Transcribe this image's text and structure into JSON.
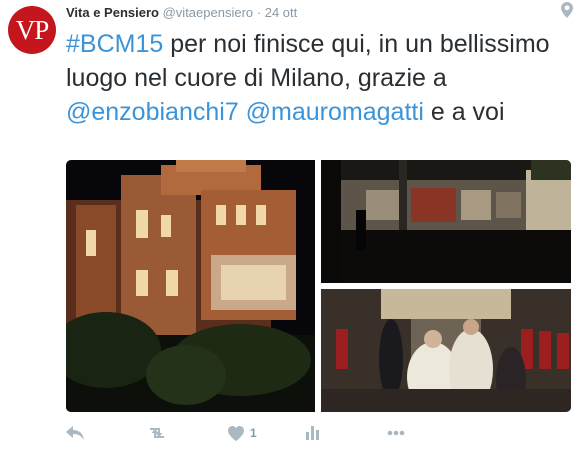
{
  "tweet": {
    "avatar_text": "VP",
    "author_name": "Vita e Pensiero",
    "handle": "@vitaepensiero",
    "separator": "·",
    "date": "24 ott",
    "text_parts": {
      "hashtag": "#BCM15",
      "t1": " per noi finisce qui, in un bellissimo luogo nel cuore di Milano, grazie a ",
      "mention1": "@enzobianchi7",
      "t2": " ",
      "mention2": "@mauromagatti",
      "t3": " e a voi"
    },
    "like_count": "1"
  },
  "colors": {
    "brand_red": "#c4161c",
    "link": "#3b94d9",
    "muted": "#aab8c2"
  },
  "icons": [
    "location-icon",
    "reply-icon",
    "retweet-icon",
    "like-icon",
    "analytics-icon",
    "more-icon"
  ]
}
